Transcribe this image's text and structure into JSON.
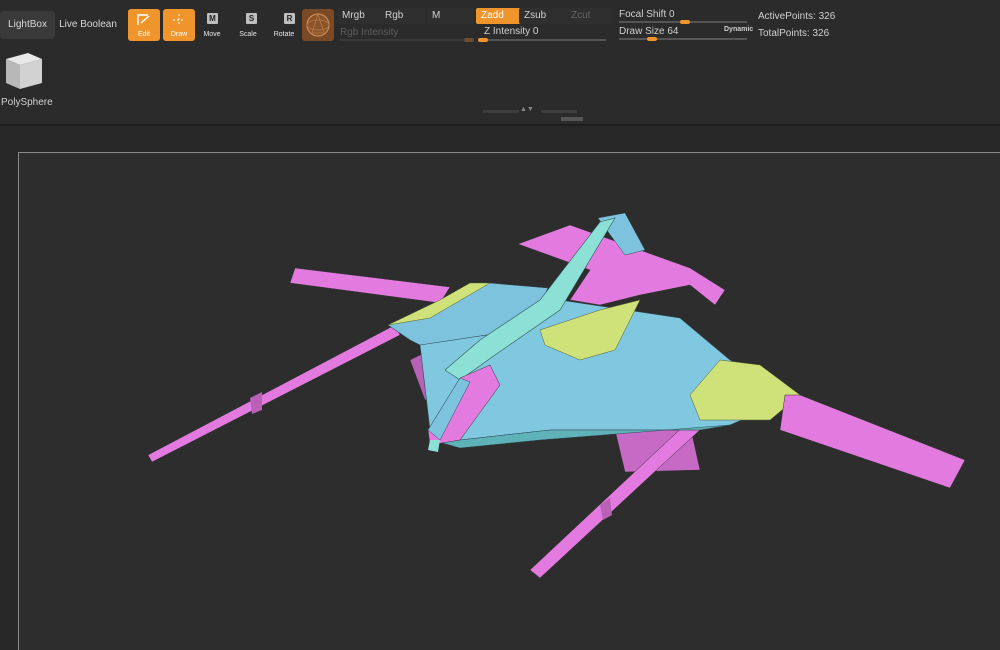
{
  "toolbar": {
    "lightbox_label": "LightBox",
    "live_boolean_label": "Live Boolean",
    "edit_label": "Edit",
    "draw_label": "Draw",
    "move_label": "Move",
    "move_key": "M",
    "scale_label": "Scale",
    "scale_key": "S",
    "rotate_label": "Rotate",
    "rotate_key": "R",
    "material_icon": "material-sphere-icon",
    "mrgb_label": "Mrgb",
    "rgb_label": "Rgb",
    "m_label": "M",
    "zadd_label": "Zadd",
    "zsub_label": "Zsub",
    "zcut_label": "Zcut",
    "rgb_intensity_label": "Rgb Intensity",
    "z_intensity_label": "Z Intensity 0",
    "focal_shift_label": "Focal Shift 0",
    "draw_size_label": "Draw Size 64",
    "dynamic_label": "Dynamic",
    "active_points": "ActivePoints: 326",
    "total_points": "TotalPoints: 326",
    "accent_color": "#f0952b"
  },
  "tool_palette": {
    "current_tool_label": "PolySphere",
    "current_tool_icon": "cube-icon"
  },
  "viewport": {
    "model_colors": [
      "#e27ae0",
      "#7ec3dd",
      "#8de0d5",
      "#cfe27a"
    ]
  }
}
